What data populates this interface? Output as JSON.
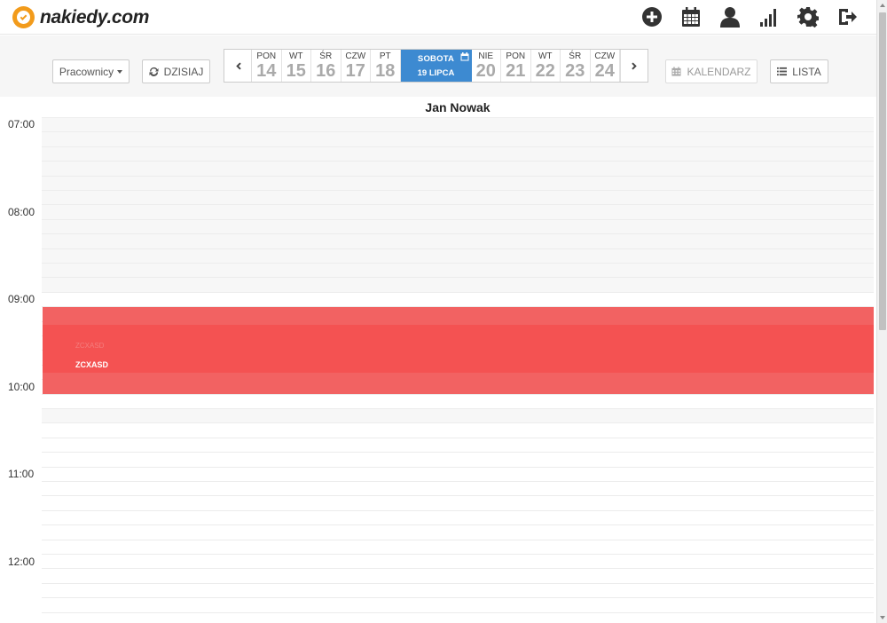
{
  "header": {
    "logo_text": "nakiedy.com",
    "icons": [
      "plus-circle-icon",
      "calendar-icon",
      "user-icon",
      "signal-bars-icon",
      "gear-icon",
      "logout-icon"
    ]
  },
  "toolbar": {
    "workers_label": "Pracownicy",
    "today_label": "DZISIAJ",
    "calendar_label": "KALENDARZ",
    "list_label": "LISTA",
    "days_before": [
      {
        "name": "PON",
        "num": "14"
      },
      {
        "name": "WT",
        "num": "15"
      },
      {
        "name": "ŚR",
        "num": "16"
      },
      {
        "name": "CZW",
        "num": "17"
      },
      {
        "name": "PT",
        "num": "18"
      }
    ],
    "active_day": {
      "name": "SOBOTA",
      "date": "19 LIPCA"
    },
    "days_after": [
      {
        "name": "NIE",
        "num": "20"
      },
      {
        "name": "PON",
        "num": "21"
      },
      {
        "name": "WT",
        "num": "22"
      },
      {
        "name": "ŚR",
        "num": "23"
      },
      {
        "name": "CZW",
        "num": "24"
      }
    ]
  },
  "calendar": {
    "person": "Jan Nowak",
    "hours": [
      "07:00",
      "08:00",
      "09:00",
      "10:00",
      "11:00",
      "12:00"
    ],
    "event": {
      "title": "ZCXASD",
      "ghost_title": "ZCXASD",
      "color": "#f26262"
    }
  }
}
